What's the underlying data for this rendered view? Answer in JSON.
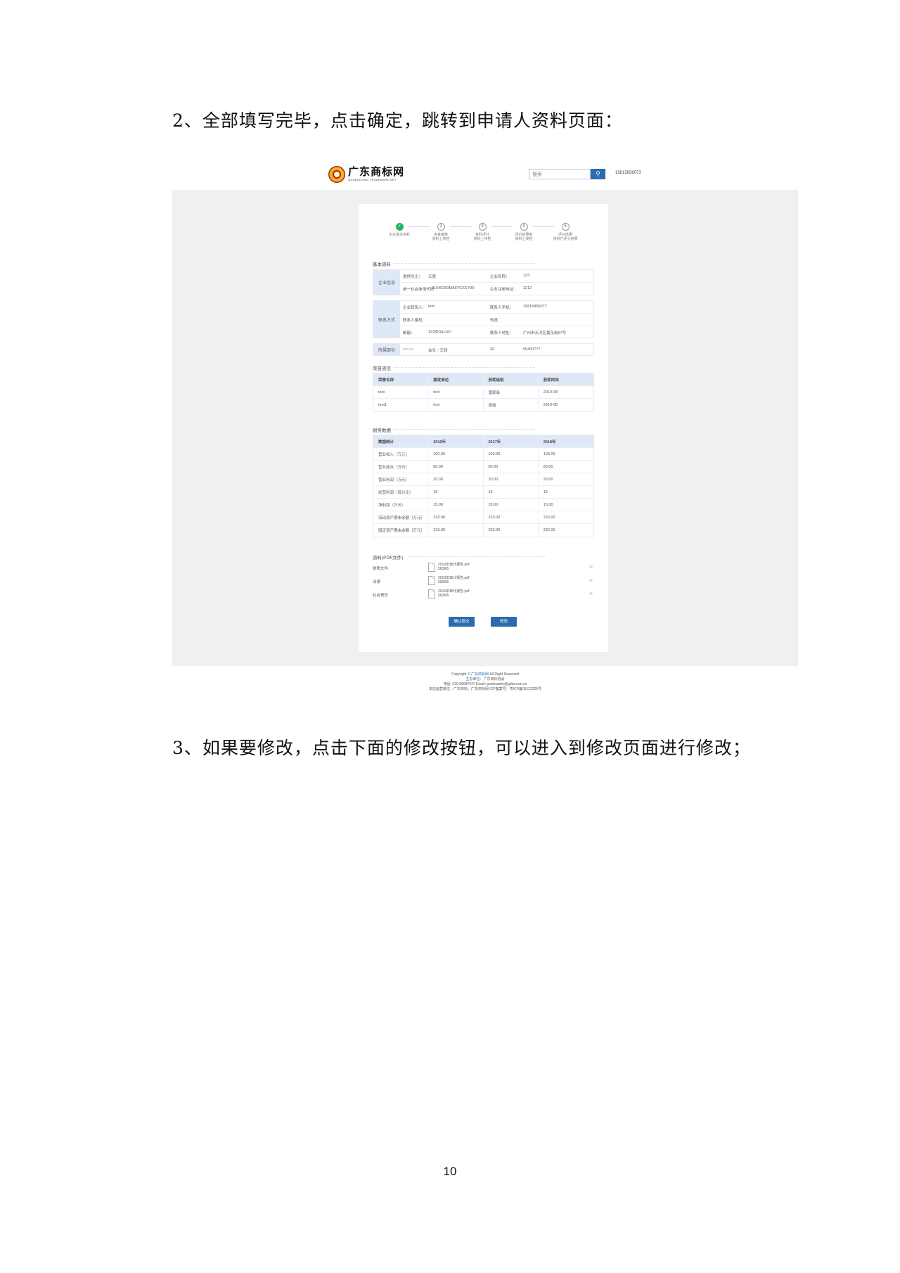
{
  "document": {
    "para1": "2、全部填写完毕，点击确定，跳转到申请人资料页面：",
    "para2": "3、如果要修改，点击下面的修改按钮，可以进入到修改页面进行修改；",
    "page_number": "10"
  },
  "screenshot": {
    "header": {
      "logo_title": "广东商标网",
      "logo_sub": "GUANGDONG TRADEMARK.NET",
      "search_placeholder": "搜索",
      "phone": "15815856073"
    },
    "steps": [
      {
        "num": "1",
        "label": "企业基本资料",
        "label2": "",
        "done": true
      },
      {
        "num": "2",
        "label": "资金审核",
        "label2": "资料上传检",
        "done": false
      },
      {
        "num": "3",
        "label": "资料评分",
        "label2": "资料上传检",
        "done": false
      },
      {
        "num": "4",
        "label": "评价结果者",
        "label2": "资料上传检",
        "done": false
      },
      {
        "num": "5",
        "label": "评价结果",
        "label2": "资料已评分结果",
        "done": false
      }
    ],
    "basic_info": {
      "title": "基本资料",
      "company": {
        "label": "企业信息",
        "rows": [
          {
            "k1": "提供所企：",
            "v1": "天骄",
            "k2": "企业名称：",
            "v2": "123"
          },
          {
            "k1": "统一社会信用代码",
            "v1": "91540200MA6TCXEY99",
            "k2": "企业注册地址：",
            "v2": "3212"
          }
        ]
      },
      "contact": {
        "label": "联系方式",
        "rows": [
          {
            "k1": "企业联系人：",
            "v1": "test",
            "k2": "联系人手机：",
            "v2": "15815856077"
          },
          {
            "k1": "联系人座机：",
            "v1": "",
            "k2": "传真：",
            "v2": ""
          },
          {
            "k1": "邮箱：",
            "v1": "123@qq.com",
            "k2": "联系人地址：",
            "v2": "广州市天河区黄花岗57号"
          }
        ]
      },
      "identity": {
        "label": "所属部份",
        "rows": [
          {
            "k1": "ww.ee",
            "v1": "会长／天骄",
            "k2": "42",
            "v2": "56400777"
          }
        ]
      }
    },
    "honor": {
      "title": "荣誉资信",
      "headers": [
        "荣誉名称",
        "颁发单位",
        "获奖级别",
        "获奖时间"
      ],
      "rows": [
        [
          "test",
          "test",
          "国家级",
          "2019-08"
        ],
        [
          "test1",
          "test",
          "省级",
          "2019-08"
        ]
      ]
    },
    "finance": {
      "title": "财务数据",
      "headers": [
        "数据统计",
        "2016年",
        "2017年",
        "2018年"
      ],
      "rows": [
        [
          "营业收入（万元）",
          "100.00",
          "100.00",
          "100.00"
        ],
        [
          "营业成本（万元）",
          "80.00",
          "80.00",
          "80.00"
        ],
        [
          "营业利润（万元）",
          "20.00",
          "20.00",
          "20.00"
        ],
        [
          "经营利润（百分比）",
          "15",
          "15",
          "15"
        ],
        [
          "净利润（万元）",
          "15.00",
          "15.00",
          "15.00"
        ],
        [
          "流动资产期末余额（万元）",
          "233.00",
          "233.00",
          "233.00"
        ],
        [
          "固定资产期末余额（万元）",
          "233.00",
          "233.00",
          "232.00"
        ]
      ]
    },
    "files": {
      "title": "资料(PDF文件)",
      "rows": [
        {
          "label": "财税文件",
          "name": "2016年审计报告.pdf",
          "size": "563KB",
          "action": "⊗"
        },
        {
          "label": "法律",
          "name": "2016年审计报告.pdf",
          "size": "563KB",
          "action": "⊗"
        },
        {
          "label": "社会责任",
          "name": "2016年审计报告.pdf",
          "size": "563KB",
          "action": "⊗"
        }
      ]
    },
    "buttons": {
      "confirm": "确认提交",
      "modify": "修改"
    },
    "footer": {
      "copyright_pre": "Copyright ©",
      "copyright_link": "广东商标网",
      "copyright_post": "All Right Reserved",
      "line2": "主办单位：广东商标协会",
      "line3": "电话: 020-86087047   Email: postmaster@gdta.com.cn",
      "line4": "本站运营单位：广东商标，广东商标网 ICP备案号：粤ICP备05122225号"
    },
    "colors": {
      "accent": "#2b6cb0",
      "done_step": "#27b36a",
      "label_bg": "#dfe8f6",
      "page_bg": "#eff0f2"
    }
  }
}
